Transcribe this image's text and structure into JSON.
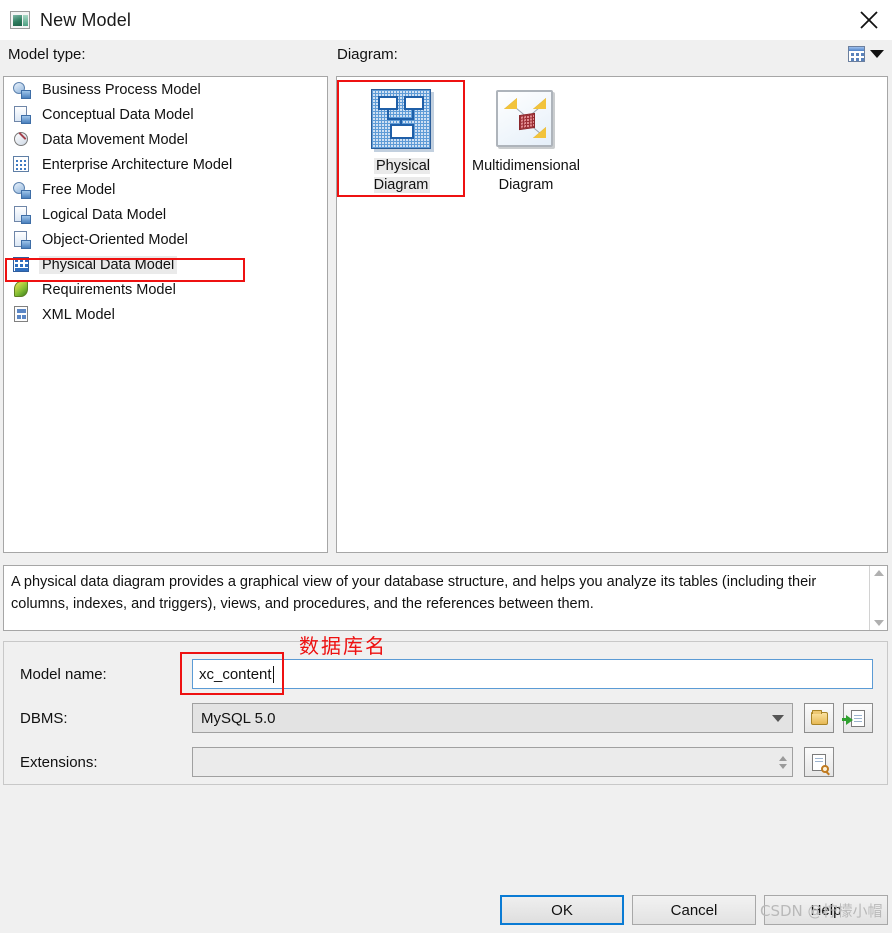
{
  "window": {
    "title": "New Model",
    "icon": "model-window-icon",
    "close_label": "✕"
  },
  "sections": {
    "model_type_label": "Model type:",
    "diagram_label": "Diagram:",
    "view_mode_icon": "grid-view-icon",
    "view_mode_caret": "chevron-down-icon"
  },
  "model_types": [
    {
      "label": "Business Process Model",
      "icon": "business-process-icon",
      "selected": false
    },
    {
      "label": "Conceptual Data Model",
      "icon": "conceptual-data-icon",
      "selected": false
    },
    {
      "label": "Data Movement Model",
      "icon": "data-movement-icon",
      "selected": false
    },
    {
      "label": "Enterprise Architecture Model",
      "icon": "enterprise-architecture-icon",
      "selected": false
    },
    {
      "label": "Free Model",
      "icon": "free-model-icon",
      "selected": false
    },
    {
      "label": "Logical Data Model",
      "icon": "logical-data-icon",
      "selected": false
    },
    {
      "label": "Object-Oriented Model",
      "icon": "object-oriented-icon",
      "selected": false
    },
    {
      "label": "Physical Data Model",
      "icon": "physical-data-icon",
      "selected": true
    },
    {
      "label": "Requirements Model",
      "icon": "requirements-icon",
      "selected": false
    },
    {
      "label": "XML Model",
      "icon": "xml-model-icon",
      "selected": false
    }
  ],
  "diagrams": [
    {
      "label": "Physical Diagram",
      "icon": "physical-diagram-thumb",
      "selected": true
    },
    {
      "label": "Multidimensional Diagram",
      "icon": "multidimensional-diagram-thumb",
      "selected": false
    }
  ],
  "description": "A physical data diagram provides a graphical view of your database structure, and helps you analyze its tables (including their columns, indexes, and triggers), views, and procedures, and the references between them.",
  "form": {
    "model_name_label": "Model name:",
    "model_name_value": "xc_content",
    "dbms_label": "DBMS:",
    "dbms_value": "MySQL 5.0",
    "extensions_label": "Extensions:",
    "extensions_value": "",
    "browse_icon": "folder-icon",
    "new_dbms_icon": "page-arrow-icon",
    "extensions_icon": "page-magnifier-icon"
  },
  "annotations": {
    "database_name_note": "数据库名",
    "note_color": "#ee1111"
  },
  "footer": {
    "ok_label": "OK",
    "cancel_label": "Cancel",
    "help_label": "Help"
  },
  "watermark": "CSDN @柠檬小帽",
  "colors": {
    "dialog_bg": "#f0f0f0",
    "panel_bg": "#ffffff",
    "accent_focus": "#0a7bd4",
    "annotation_red": "#ee1111",
    "selection_gray": "#eaeaea"
  }
}
